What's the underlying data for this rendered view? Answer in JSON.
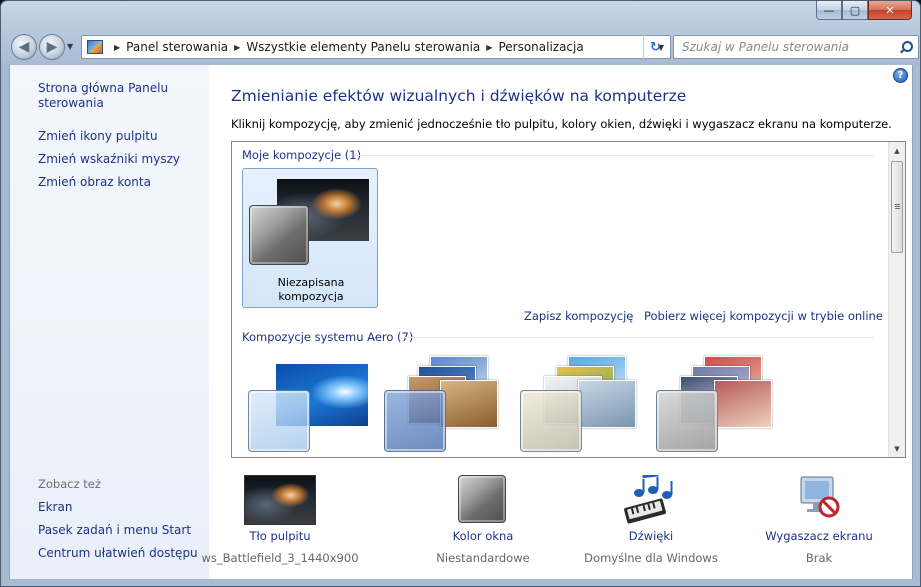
{
  "window": {
    "caption_buttons": {
      "minimize": "—",
      "maximize": "▢",
      "close": "✕"
    }
  },
  "nav": {
    "back_icon": "back-arrow-icon",
    "forward_icon": "forward-arrow-icon",
    "breadcrumb": [
      "Panel sterowania",
      "Wszystkie elementy Panelu sterowania",
      "Personalizacja"
    ],
    "search_placeholder": "Szukaj w Panelu sterowania"
  },
  "sidebar": {
    "home_link": "Strona główna Panelu sterowania",
    "links": [
      "Zmień ikony pulpitu",
      "Zmień wskaźniki myszy",
      "Zmień obraz konta"
    ],
    "see_also_label": "Zobacz też",
    "see_also": [
      "Ekran",
      "Pasek zadań i menu Start",
      "Centrum ułatwień dostępu"
    ]
  },
  "main": {
    "title": "Zmienianie efektów wizualnych i dźwięków na komputerze",
    "description": "Kliknij kompozycję, aby zmienić jednocześnie tło pulpitu, kolory okien, dźwięki i wygaszacz ekranu na komputerze.",
    "my_themes_label": "Moje kompozycje (1)",
    "my_themes": [
      {
        "name_line1": "Niezapisana",
        "name_line2": "kompozycja",
        "selected": true
      }
    ],
    "save_theme_link": "Zapisz kompozycję",
    "get_more_link": "Pobierz więcej kompozycji w trybie online",
    "aero_label": "Kompozycje systemu Aero (7)"
  },
  "bottom": [
    {
      "title": "Tło pulpitu",
      "value": "ws_Battlefield_3_1440x900",
      "icon": "desktop-background-thumbnail"
    },
    {
      "title": "Kolor okna",
      "value": "Niestandardowe",
      "icon": "window-color-swatch"
    },
    {
      "title": "Dźwięki",
      "value": "Domyślne dla Windows",
      "icon": "sounds-notes-icon"
    },
    {
      "title": "Wygaszacz ekranu",
      "value": "Brak",
      "icon": "screensaver-none-icon"
    }
  ],
  "colors": {
    "link": "#1e3287",
    "accent_blue": "#1c58b5",
    "selected_tile": "#d5e6fa"
  }
}
